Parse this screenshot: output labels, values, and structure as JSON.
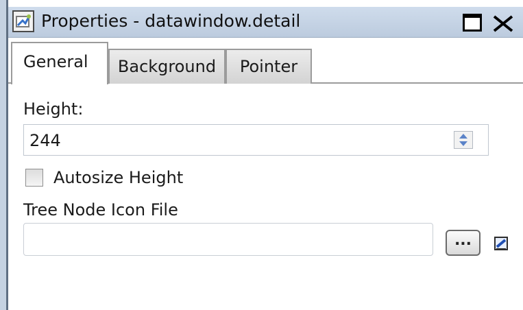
{
  "window": {
    "title": "Properties - datawindow.detail"
  },
  "tabs": [
    {
      "label": "General",
      "active": true
    },
    {
      "label": "Background",
      "active": false
    },
    {
      "label": "Pointer",
      "active": false
    }
  ],
  "general": {
    "height_label": "Height:",
    "height_value": "244",
    "autosize_label": "Autosize Height",
    "autosize_checked": false,
    "tree_icon_label": "Tree Node Icon File",
    "tree_icon_value": "",
    "browse_label": "...",
    "icons": [
      "properties-window-icon",
      "maximize-icon",
      "close-icon",
      "spinner-icon",
      "browse-icon",
      "edit-field-icon"
    ]
  },
  "colors": {
    "titlebar": "#c8d6e8",
    "tab_border": "#9b9b9b",
    "inactive_tab": "#dcdcdc"
  }
}
